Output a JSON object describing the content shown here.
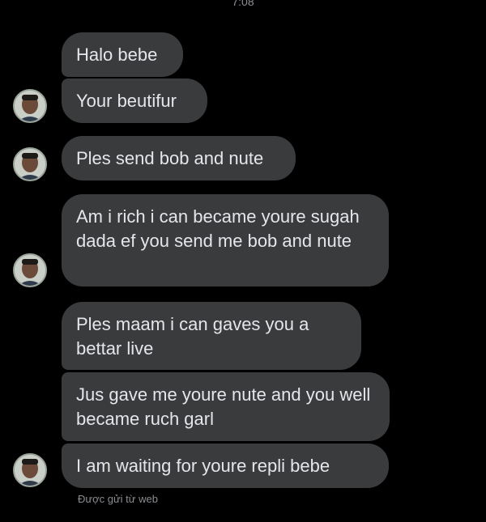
{
  "status_time": "7:08",
  "messages": [
    {
      "text": "Halo bebe"
    },
    {
      "text": "Your beutifur"
    },
    {
      "text": "Ples send bob and nute"
    },
    {
      "text": "Am i rich i can became youre sugah dada ef you send me bob and nute"
    },
    {
      "text": "Ples maam i can gaves you a bettar live"
    },
    {
      "text": "Jus gave me youre nute and you well became ruch garl"
    },
    {
      "text": "I am waiting for youre repli bebe"
    }
  ],
  "footer_note": "Được gửi từ web",
  "colors": {
    "background": "#000000",
    "bubble": "#3a3b3c",
    "text": "#e4e6eb",
    "muted": "#8a8d91"
  },
  "icons": {
    "avatar": "sender-avatar"
  }
}
